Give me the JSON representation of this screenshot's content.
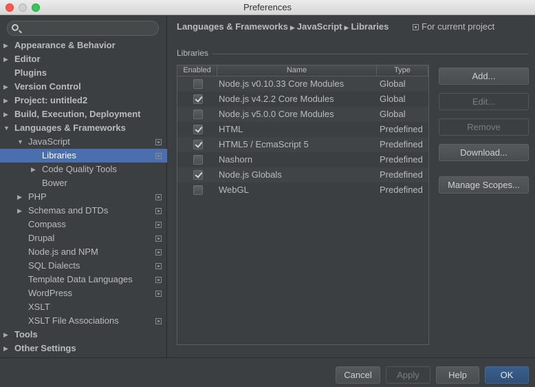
{
  "window": {
    "title": "Preferences"
  },
  "search": {
    "placeholder": ""
  },
  "sidebar": {
    "items": [
      {
        "label": "Appearance & Behavior",
        "level": 0,
        "arrow": "right",
        "bold": true,
        "project": false
      },
      {
        "label": "Editor",
        "level": 0,
        "arrow": "right",
        "bold": true,
        "project": false
      },
      {
        "label": "Plugins",
        "level": 0,
        "arrow": "",
        "bold": true,
        "project": false
      },
      {
        "label": "Version Control",
        "level": 0,
        "arrow": "right",
        "bold": true,
        "project": false
      },
      {
        "label": "Project: untitled2",
        "level": 0,
        "arrow": "right",
        "bold": true,
        "project": false
      },
      {
        "label": "Build, Execution, Deployment",
        "level": 0,
        "arrow": "right",
        "bold": true,
        "project": false
      },
      {
        "label": "Languages & Frameworks",
        "level": 0,
        "arrow": "down",
        "bold": true,
        "project": false
      },
      {
        "label": "JavaScript",
        "level": 1,
        "arrow": "down",
        "bold": false,
        "project": true
      },
      {
        "label": "Libraries",
        "level": 2,
        "arrow": "",
        "bold": false,
        "project": true,
        "selected": true
      },
      {
        "label": "Code Quality Tools",
        "level": 2,
        "arrow": "right",
        "bold": false,
        "project": false
      },
      {
        "label": "Bower",
        "level": 2,
        "arrow": "",
        "bold": false,
        "project": false
      },
      {
        "label": "PHP",
        "level": 1,
        "arrow": "right",
        "bold": false,
        "project": true
      },
      {
        "label": "Schemas and DTDs",
        "level": 1,
        "arrow": "right",
        "bold": false,
        "project": true
      },
      {
        "label": "Compass",
        "level": 1,
        "arrow": "",
        "bold": false,
        "project": true
      },
      {
        "label": "Drupal",
        "level": 1,
        "arrow": "",
        "bold": false,
        "project": true
      },
      {
        "label": "Node.js and NPM",
        "level": 1,
        "arrow": "",
        "bold": false,
        "project": true
      },
      {
        "label": "SQL Dialects",
        "level": 1,
        "arrow": "",
        "bold": false,
        "project": true
      },
      {
        "label": "Template Data Languages",
        "level": 1,
        "arrow": "",
        "bold": false,
        "project": true
      },
      {
        "label": "WordPress",
        "level": 1,
        "arrow": "",
        "bold": false,
        "project": true
      },
      {
        "label": "XSLT",
        "level": 1,
        "arrow": "",
        "bold": false,
        "project": false
      },
      {
        "label": "XSLT File Associations",
        "level": 1,
        "arrow": "",
        "bold": false,
        "project": true
      },
      {
        "label": "Tools",
        "level": 0,
        "arrow": "right",
        "bold": true,
        "project": false
      },
      {
        "label": "Other Settings",
        "level": 0,
        "arrow": "right",
        "bold": true,
        "project": false
      }
    ]
  },
  "breadcrumb": {
    "part1": "Languages & Frameworks",
    "part2": "JavaScript",
    "part3": "Libraries"
  },
  "scope": {
    "label": "For current project"
  },
  "libraries": {
    "group_label": "Libraries",
    "headers": {
      "enabled": "Enabled",
      "name": "Name",
      "type": "Type"
    },
    "rows": [
      {
        "enabled": false,
        "name": "Node.js v0.10.33 Core Modules",
        "type": "Global"
      },
      {
        "enabled": true,
        "name": "Node.js v4.2.2 Core Modules",
        "type": "Global"
      },
      {
        "enabled": false,
        "name": "Node.js v5.0.0 Core Modules",
        "type": "Global"
      },
      {
        "enabled": true,
        "name": "HTML",
        "type": "Predefined"
      },
      {
        "enabled": true,
        "name": "HTML5 / EcmaScript 5",
        "type": "Predefined"
      },
      {
        "enabled": false,
        "name": "Nashorn",
        "type": "Predefined"
      },
      {
        "enabled": true,
        "name": "Node.js Globals",
        "type": "Predefined"
      },
      {
        "enabled": false,
        "name": "WebGL",
        "type": "Predefined"
      }
    ]
  },
  "actions": {
    "add": "Add...",
    "edit": "Edit...",
    "remove": "Remove",
    "download": "Download...",
    "manage_scopes": "Manage Scopes..."
  },
  "footer": {
    "cancel": "Cancel",
    "apply": "Apply",
    "help": "Help",
    "ok": "OK"
  },
  "colors": {
    "selection": "#4b6eaf",
    "background": "#3c3f41",
    "ok_button": "#385f8c"
  }
}
